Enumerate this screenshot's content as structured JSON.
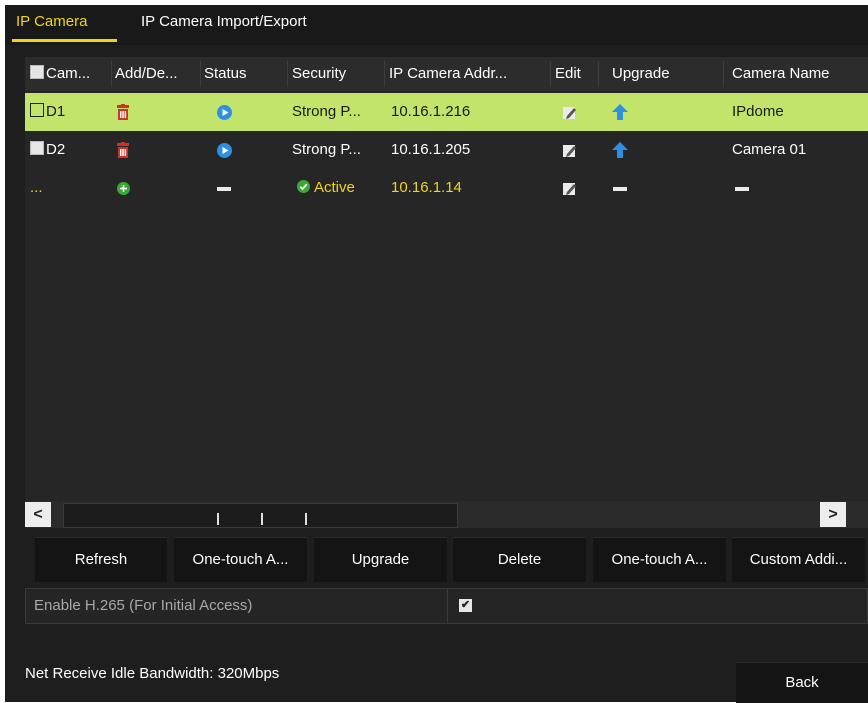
{
  "tabs": [
    {
      "label": "IP Camera"
    },
    {
      "label": "IP Camera Import/Export"
    }
  ],
  "table": {
    "columns": [
      "Cam...",
      "Add/De...",
      "Status",
      "Security",
      "IP Camera Addr...",
      "Edit",
      "Upgrade",
      "Camera Name"
    ],
    "rows": [
      {
        "camera_no": "D1",
        "add_delete": "delete-icon",
        "status": "play-icon",
        "security": "Strong P...",
        "ip_address": "10.16.1.216",
        "edit": "edit-icon",
        "upgrade": "upgrade-icon",
        "camera_name": "IPdome",
        "selected": true
      },
      {
        "camera_no": "D2",
        "add_delete": "delete-icon",
        "status": "play-icon",
        "security": "Strong P...",
        "ip_address": "10.16.1.205",
        "edit": "edit-icon",
        "upgrade": "upgrade-icon",
        "camera_name": "Camera 01",
        "selected": false
      },
      {
        "camera_no": "...",
        "add_delete": "add-icon",
        "status": "dash-icon",
        "security": "Active",
        "ip_address": "10.16.1.14",
        "edit": "edit-icon",
        "upgrade": "dash-icon",
        "camera_name": "dash-icon",
        "selected": false
      }
    ]
  },
  "scrollbar": {
    "left_arrow": "<",
    "right_arrow": ">"
  },
  "buttons": {
    "refresh": "Refresh",
    "one_touch_activate": "One-touch A...",
    "upgrade": "Upgrade",
    "delete": "Delete",
    "one_touch_adding": "One-touch A...",
    "custom_adding": "Custom Addi..."
  },
  "h265": {
    "label": "Enable H.265 (For Initial Access)",
    "checked": true,
    "check_glyph": "✔"
  },
  "bandwidth": {
    "label": "Net Receive Idle Bandwidth: 320Mbps"
  },
  "back_button": "Back",
  "colors": {
    "accent": "#f2d41a",
    "selected_row": "#c3e46a",
    "delete_red": "#d0322a",
    "status_blue": "#2f8fe0",
    "add_green": "#3aa838"
  }
}
